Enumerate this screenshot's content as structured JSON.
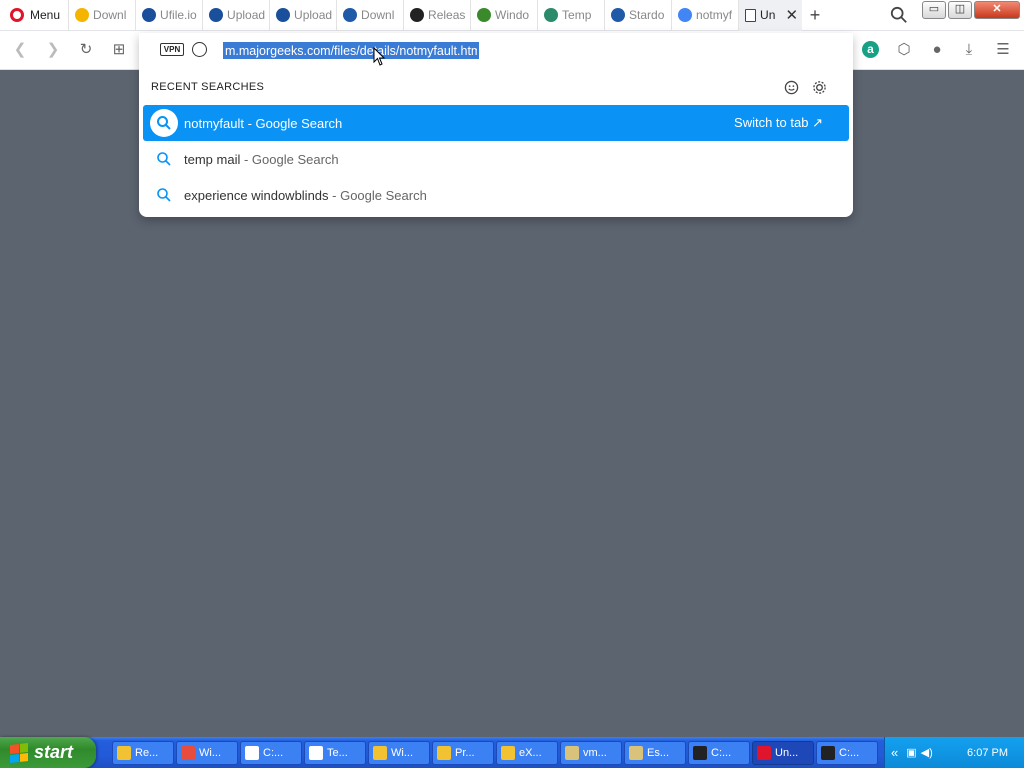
{
  "browser": {
    "menu_label": "Menu",
    "tabs": [
      {
        "label": "Downl",
        "icon": "chrome-icon",
        "color": "#f4b400"
      },
      {
        "label": "Ufile.io",
        "icon": "ufile-icon",
        "color": "#1a4f9c"
      },
      {
        "label": "Upload",
        "icon": "ufile-icon",
        "color": "#1a4f9c"
      },
      {
        "label": "Upload",
        "icon": "ufile-icon",
        "color": "#1a4f9c"
      },
      {
        "label": "Downl",
        "icon": "stardock-icon",
        "color": "#1e5aa8"
      },
      {
        "label": "Releas",
        "icon": "github-icon",
        "color": "#222222"
      },
      {
        "label": "Windo",
        "icon": "windowblinds-icon",
        "color": "#3a8a2b"
      },
      {
        "label": "Temp",
        "icon": "tempmail-icon",
        "color": "#2a8a6a"
      },
      {
        "label": "Stardo",
        "icon": "stardock-icon",
        "color": "#1e5aa8"
      },
      {
        "label": "notmyf",
        "icon": "google-icon",
        "color": "#4285f4"
      }
    ],
    "active_tab": {
      "label": "Un"
    },
    "new_tab_symbol": "+",
    "window_controls": {
      "minimize": "▭",
      "restore": "◫",
      "close": "✕"
    }
  },
  "address": {
    "vpn_label": "VPN",
    "url": "m.majorgeeks.com/files/details/notmyfault.html",
    "recent_label": "RECENT SEARCHES",
    "suggestions": [
      {
        "query": "notmyfault",
        "suffix": " - Google Search",
        "action": "Switch to tab",
        "action_icon": "↗"
      },
      {
        "query": "temp mail",
        "suffix": " - Google Search"
      },
      {
        "query": "experience windowblinds",
        "suffix": " - Google Search"
      }
    ]
  },
  "taskbar": {
    "start_label": "start",
    "tasks": [
      {
        "label": "Re...",
        "color": "#f1c232"
      },
      {
        "label": "Wi...",
        "color": "#e74c3c"
      },
      {
        "label": "C:...",
        "color": "#ffffff"
      },
      {
        "label": "Te...",
        "color": "#ffffff"
      },
      {
        "label": "Wi...",
        "color": "#f1c232"
      },
      {
        "label": "Pr...",
        "color": "#f1c232"
      },
      {
        "label": "eX...",
        "color": "#f1c232"
      },
      {
        "label": "vm...",
        "color": "#d9c27a"
      },
      {
        "label": "Es...",
        "color": "#d9c27a"
      },
      {
        "label": "C:...",
        "color": "#222222"
      },
      {
        "label": "Un...",
        "color": "#e0142b"
      },
      {
        "label": "C:...",
        "color": "#222222"
      }
    ],
    "clock": "6:07 PM"
  }
}
